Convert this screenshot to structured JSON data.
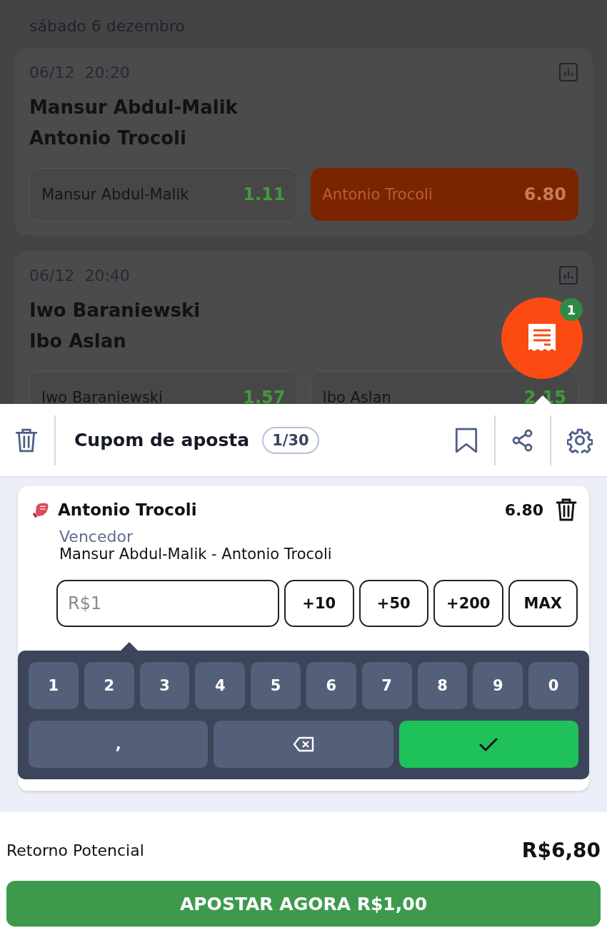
{
  "date_header": "sábado 6 dezembro",
  "matches": [
    {
      "time": "06/12  20:20",
      "fighters": [
        "Mansur Abdul-Malik",
        "Antonio Trocoli"
      ],
      "odds": [
        {
          "name": "Mansur Abdul-Malik",
          "value": "1.11",
          "selected": false
        },
        {
          "name": "Antonio Trocoli",
          "value": "6.80",
          "selected": true
        }
      ]
    },
    {
      "time": "06/12  20:40",
      "fighters": [
        "Iwo Baraniewski",
        "Ibo Aslan"
      ],
      "odds": [
        {
          "name": "Iwo Baraniewski",
          "value": "1.57",
          "selected": false
        },
        {
          "name": "Ibo Aslan",
          "value": "2.15",
          "selected": false
        }
      ]
    }
  ],
  "fab": {
    "badge": "1"
  },
  "betslip": {
    "title": "Cupom de aposta",
    "count": "1/30",
    "selection": {
      "name": "Antonio Trocoli",
      "odds": "6.80",
      "market": "Vencedor",
      "event": "Mansur Abdul-Malik - Antonio Trocoli"
    },
    "stake": {
      "placeholder": "R$1"
    },
    "quick_amounts": [
      "+10",
      "+50",
      "+200",
      "MAX"
    ],
    "keypad": {
      "digits": [
        "1",
        "2",
        "3",
        "4",
        "5",
        "6",
        "7",
        "8",
        "9",
        "0"
      ],
      "comma": ","
    },
    "potential_return": {
      "label": "Retorno Potencial",
      "value": "R$6,80"
    },
    "submit": "APOSTAR AGORA R$1,00"
  }
}
